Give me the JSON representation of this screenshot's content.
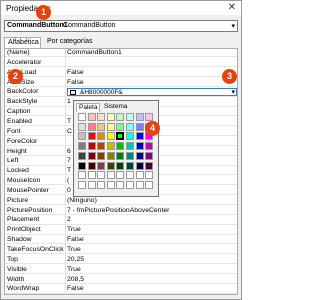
{
  "window": {
    "title": "Propiedades",
    "close_glyph": "✕"
  },
  "object_selector": {
    "name": "CommandButton1",
    "type": "CommandButton",
    "arrow": "▾"
  },
  "tabs": [
    {
      "label": "Alfabética"
    },
    {
      "label": "Por categorías"
    }
  ],
  "properties": [
    {
      "key": "(Name)",
      "value": "CommandButton1"
    },
    {
      "key": "Accelerator",
      "value": ""
    },
    {
      "key": "AutoLoad",
      "value": "False"
    },
    {
      "key": "AutoSize",
      "value": "False"
    },
    {
      "key": "BackColor",
      "value": "&H8000000F&"
    },
    {
      "key": "BackStyle",
      "value": "1"
    },
    {
      "key": "Caption",
      "value": ""
    },
    {
      "key": "Enabled",
      "value": "T"
    },
    {
      "key": "Font",
      "value": "C"
    },
    {
      "key": "ForeColor",
      "value": ""
    },
    {
      "key": "Height",
      "value": "6"
    },
    {
      "key": "Left",
      "value": "7"
    },
    {
      "key": "Locked",
      "value": "T"
    },
    {
      "key": "MouseIcon",
      "value": "("
    },
    {
      "key": "MousePointer",
      "value": "0"
    },
    {
      "key": "Picture",
      "value": "(Ninguno)"
    },
    {
      "key": "PicturePosition",
      "value": "7 - fmPicturePositionAboveCenter"
    },
    {
      "key": "Placement",
      "value": "2"
    },
    {
      "key": "PrintObject",
      "value": "True"
    },
    {
      "key": "Shadow",
      "value": "False"
    },
    {
      "key": "TakeFocusOnClick",
      "value": "True"
    },
    {
      "key": "Top",
      "value": "20,25"
    },
    {
      "key": "Visible",
      "value": "True"
    },
    {
      "key": "Width",
      "value": "208,5"
    },
    {
      "key": "WordWrap",
      "value": "False"
    }
  ],
  "palette": {
    "tabs": [
      {
        "label": "Paleta"
      },
      {
        "label": "Sistema"
      }
    ],
    "dropdown_arrow": "▾",
    "colors": [
      "#ffffff",
      "#ffc0c0",
      "#ffe0c0",
      "#ffffc0",
      "#c0ffc0",
      "#c0ffff",
      "#c0c0ff",
      "#ffc0ff",
      "#e0e0e0",
      "#ff8080",
      "#ffc080",
      "#ffff80",
      "#80ff80",
      "#80ffff",
      "#8080ff",
      "#ff80ff",
      "#c0c0c0",
      "#ff0000",
      "#ff8000",
      "#ffff00",
      "#00ff00",
      "#00ffff",
      "#0000ff",
      "#ff00ff",
      "#808080",
      "#c00000",
      "#c04000",
      "#c0c000",
      "#00c000",
      "#00c0c0",
      "#0000c0",
      "#c000c0",
      "#404040",
      "#800000",
      "#804000",
      "#808000",
      "#008000",
      "#008080",
      "#000080",
      "#800080",
      "#000000",
      "#400000",
      "#804040",
      "#404000",
      "#004000",
      "#004040",
      "#000040",
      "#400040",
      "#ffffff",
      "#ffffff",
      "#ffffff",
      "#ffffff",
      "#ffffff",
      "#ffffff",
      "#ffffff",
      "#ffffff",
      "#ffffff",
      "#ffffff",
      "#ffffff",
      "#ffffff",
      "#ffffff",
      "#ffffff",
      "#ffffff",
      "#ffffff"
    ],
    "selected_index": 20
  },
  "badges": [
    {
      "label": "1"
    },
    {
      "label": "2"
    },
    {
      "label": "3"
    },
    {
      "label": "4"
    }
  ],
  "colors": {
    "badge": "#e8420c",
    "focus_border": "#3c78d8"
  }
}
